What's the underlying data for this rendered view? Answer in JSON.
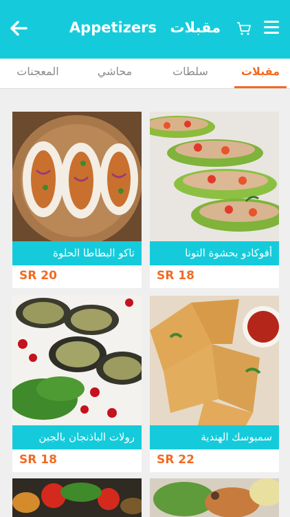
{
  "header": {
    "title_en": "Appetizers",
    "title_ar": "مقبلات",
    "back_icon": "back-arrow-icon",
    "cart_icon": "cart-icon",
    "menu_icon": "hamburger-menu-icon"
  },
  "tabs": [
    {
      "label": "مقبلات",
      "active": true
    },
    {
      "label": "سلطات",
      "active": false
    },
    {
      "label": "محاشي",
      "active": false
    },
    {
      "label": "المعجنات",
      "active": false
    }
  ],
  "products": [
    {
      "name": "أفوكادو بحشوة التونا",
      "price": "SR 18"
    },
    {
      "name": "تاكو البطاطا الحلوة",
      "price": "SR 20"
    },
    {
      "name": "سمبوسك الهندية",
      "price": "SR 22"
    },
    {
      "name": "رولات الباذنجان بالجبن",
      "price": "SR 18"
    }
  ],
  "colors": {
    "accent": "#15cbdb",
    "price": "#f26a22"
  }
}
